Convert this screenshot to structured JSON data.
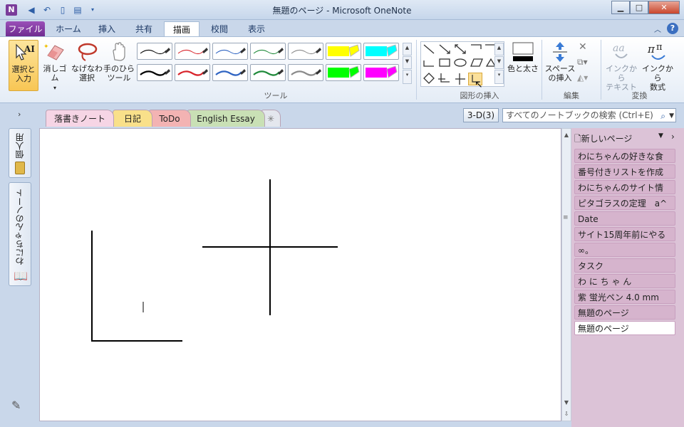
{
  "window": {
    "title": "無題のページ - Microsoft OneNote",
    "min_icon": "minimize-icon",
    "max_icon": "maximize-icon",
    "close_icon": "close-icon"
  },
  "ribbon_tabs": [
    "ファイル",
    "ホーム",
    "挿入",
    "共有",
    "描画",
    "校閲",
    "表示"
  ],
  "active_tab": "描画",
  "ribbon": {
    "tools": {
      "select_text": "選択と\n入力",
      "eraser": "消しゴム",
      "lasso": "なげなわ\n選択",
      "pan": "手のひら\nツール",
      "group_label": "ツール"
    },
    "pens": [
      {
        "color": "#000000",
        "kind": "pen"
      },
      {
        "color": "#d8232a",
        "kind": "pen"
      },
      {
        "color": "#2f64c2",
        "kind": "pen"
      },
      {
        "color": "#1f8a3a",
        "kind": "pen"
      },
      {
        "color": "#8a8a8a",
        "kind": "pen"
      },
      {
        "color": "#ffff00",
        "kind": "highlighter"
      },
      {
        "color": "#00ffff",
        "kind": "highlighter"
      },
      {
        "color": "#000000",
        "kind": "pen-thick"
      },
      {
        "color": "#d8232a",
        "kind": "pen-thick"
      },
      {
        "color": "#2f64c2",
        "kind": "pen-thick"
      },
      {
        "color": "#1f8a3a",
        "kind": "pen-thick"
      },
      {
        "color": "#8a8a8a",
        "kind": "pen-thick"
      },
      {
        "color": "#00ff00",
        "kind": "highlighter"
      },
      {
        "color": "#ff00ff",
        "kind": "highlighter"
      }
    ],
    "shapes_group_label": "図形の挿入",
    "color_width": "色と太さ",
    "space": "スペース\nの挿入",
    "edit_group_label": "編集",
    "ink_to_text": "インクから\nテキスト",
    "ink_to_math": "インクから\n数式",
    "convert_group_label": "変換"
  },
  "notebook_tabs": [
    {
      "label": "落書きノート",
      "color": "#f6d5e5",
      "active": true
    },
    {
      "label": "日記",
      "color": "#f9e08a",
      "active": false
    },
    {
      "label": "ToDo",
      "color": "#f3b3b3",
      "active": false
    },
    {
      "label": "English Essay",
      "color": "#c9e0b5",
      "active": false
    }
  ],
  "btn_3d": "3-D(3)",
  "search_placeholder": "すべてのノートブックの検索 (Ctrl+E)",
  "left_notebooks": [
    "個人用",
    "わにちゃんのノート"
  ],
  "new_page": "新しいページ",
  "pages": [
    "わにちゃんの好きな食",
    "番号付きリストを作成",
    "わにちゃんのサイト情",
    "ピタゴラスの定理　a^",
    "Date",
    "サイト15周年前にやる",
    "∞。",
    "タスク",
    "わ に ち ゃ ん",
    "紫 蛍光ペン 4.0 mm",
    "無題のページ",
    "無題のページ"
  ],
  "current_page_index": 11
}
